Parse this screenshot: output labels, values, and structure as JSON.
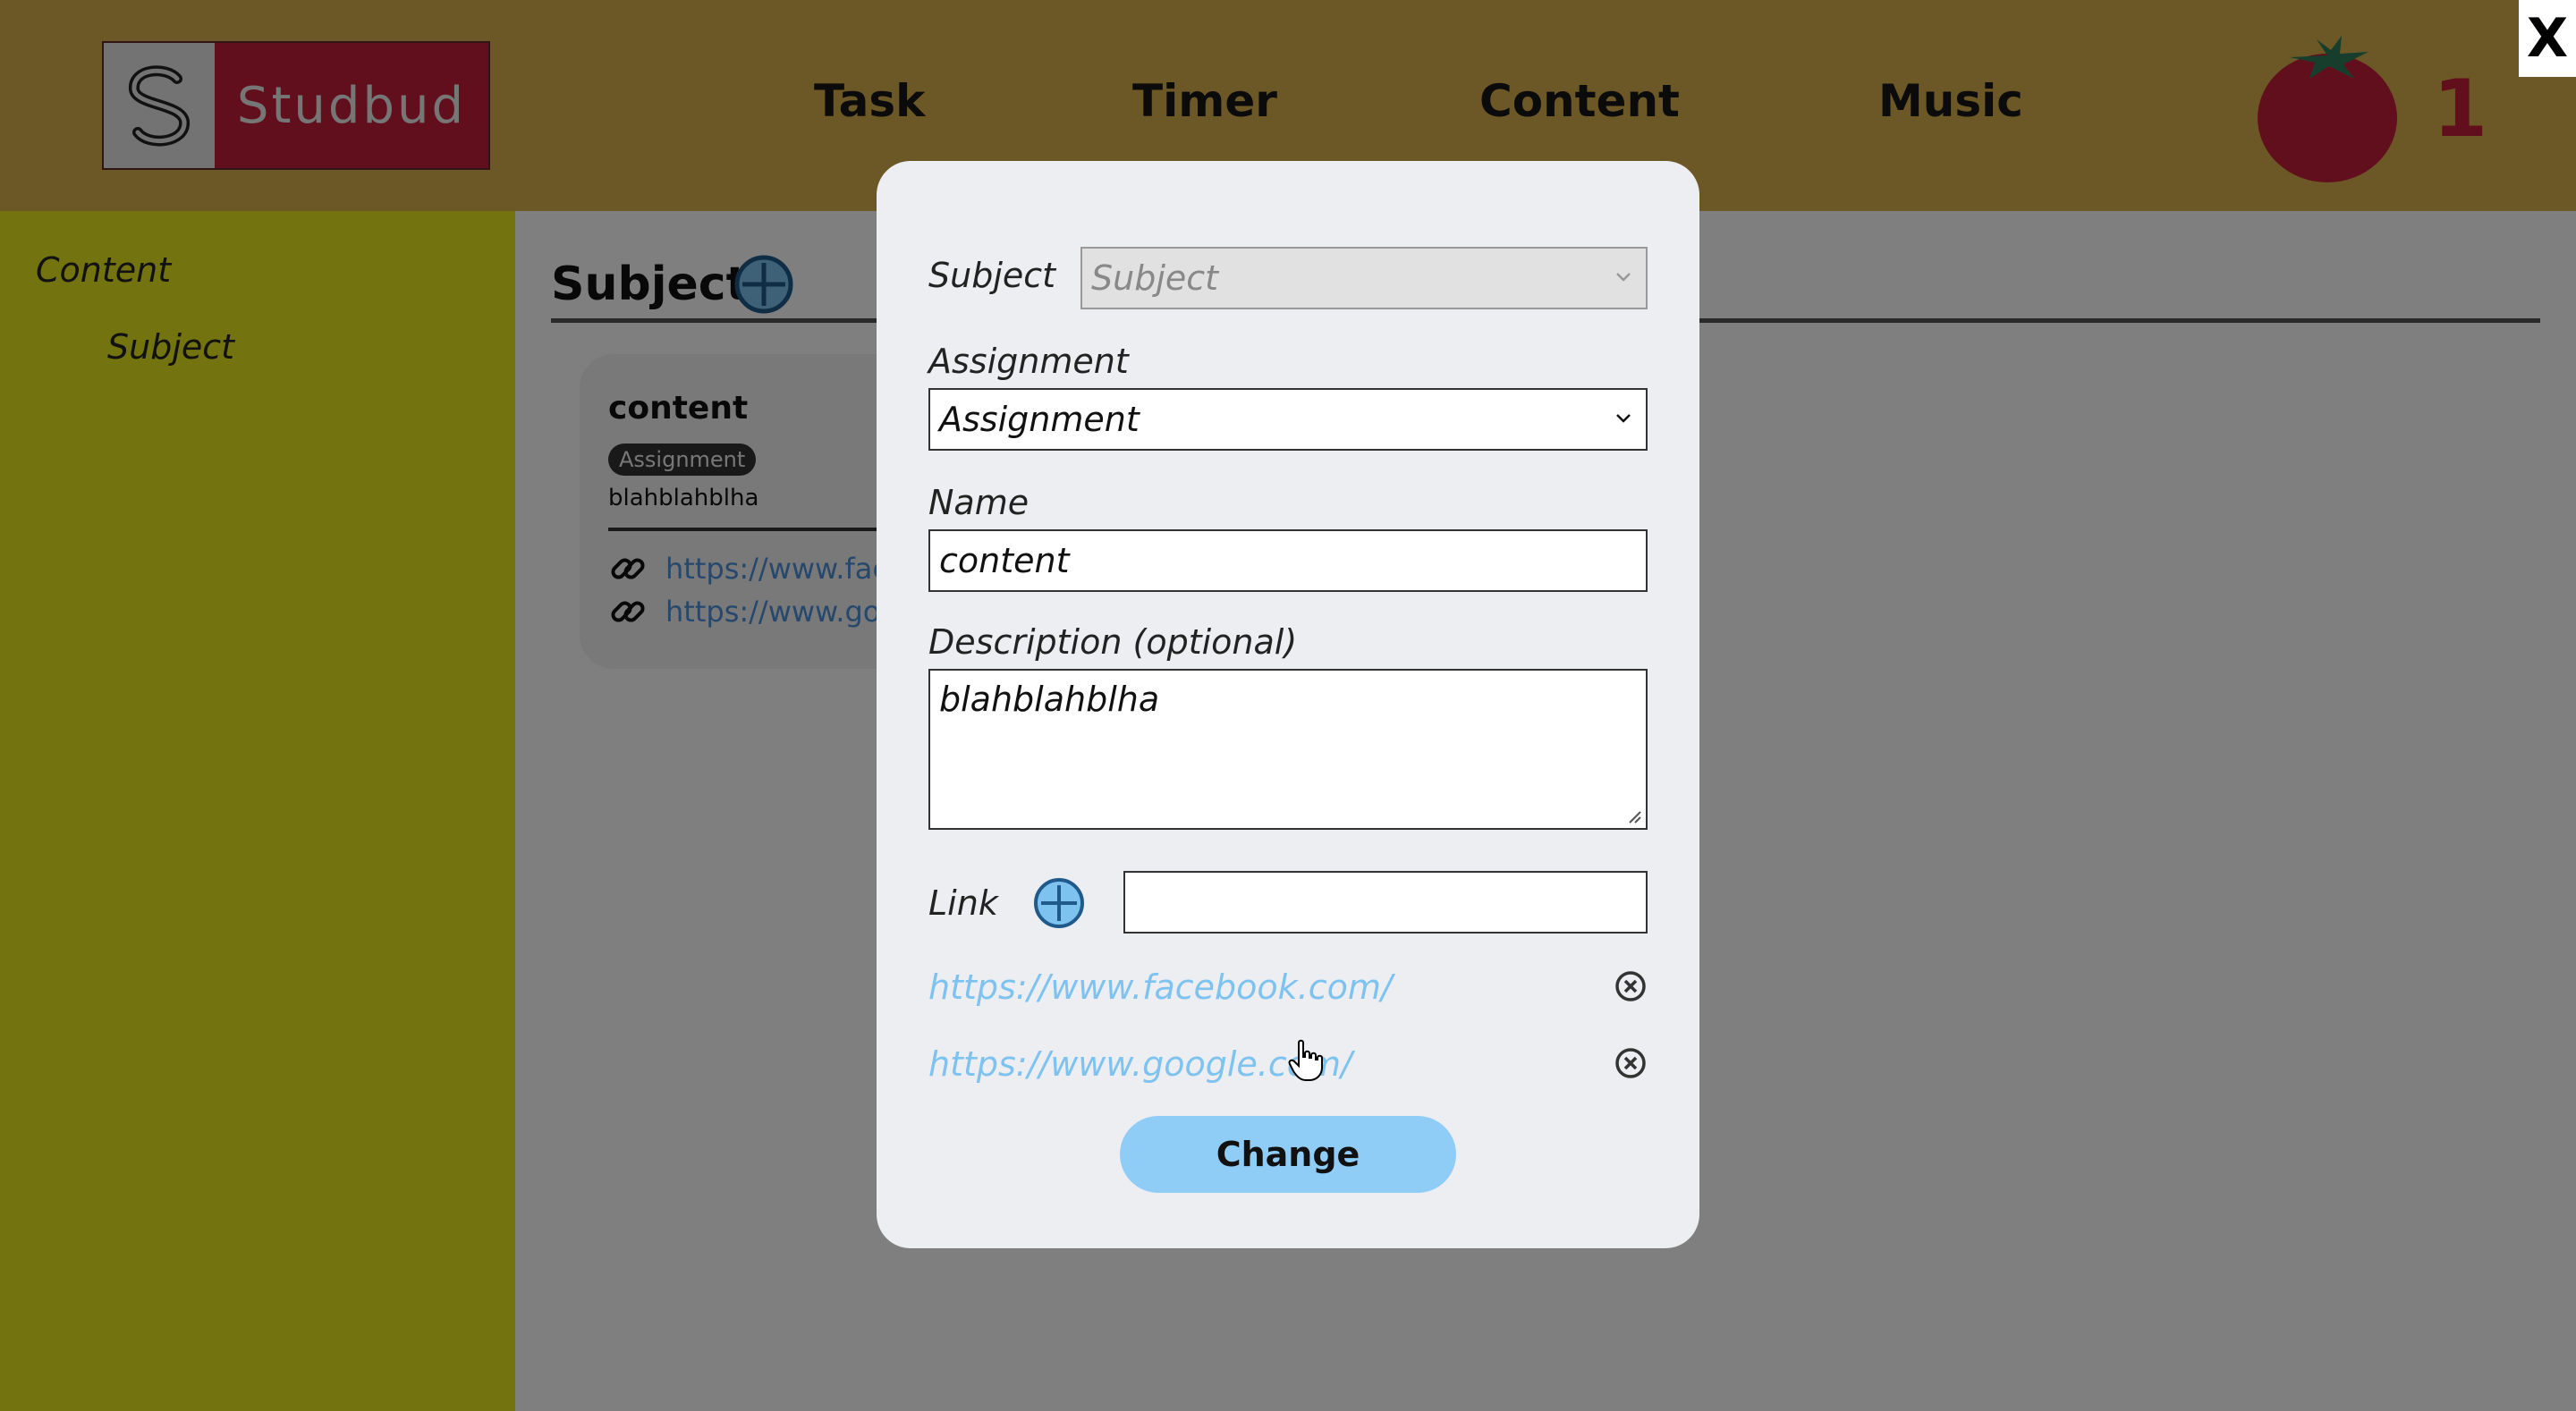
{
  "header": {
    "logo_text": "Studbud",
    "nav": [
      "Task",
      "Timer",
      "Content",
      "Music"
    ],
    "pomodoro_count": "1",
    "close_label": "X",
    "colors": {
      "header_bg": "#d9b04c",
      "logo_red": "#c41e3a",
      "tomato": "#c41e3a"
    }
  },
  "sidebar": {
    "items": [
      {
        "label": "Content"
      },
      {
        "label": "Subject"
      }
    ]
  },
  "main": {
    "section_title": "Subject",
    "card": {
      "title": "content",
      "badge": "Assignment",
      "description": "blahblahblha",
      "links": [
        "https://www.fac",
        "https://www.go"
      ]
    }
  },
  "modal": {
    "subject_label": "Subject",
    "subject_placeholder": "Subject",
    "assignment_label": "Assignment",
    "assignment_value": "Assignment",
    "name_label": "Name",
    "name_value": "content",
    "description_label": "Description (optional)",
    "description_value": "blahblahblha",
    "link_label": "Link",
    "link_value": "",
    "links": [
      "https://www.facebook.com/",
      "https://www.google.com/"
    ],
    "submit_label": "Change"
  }
}
